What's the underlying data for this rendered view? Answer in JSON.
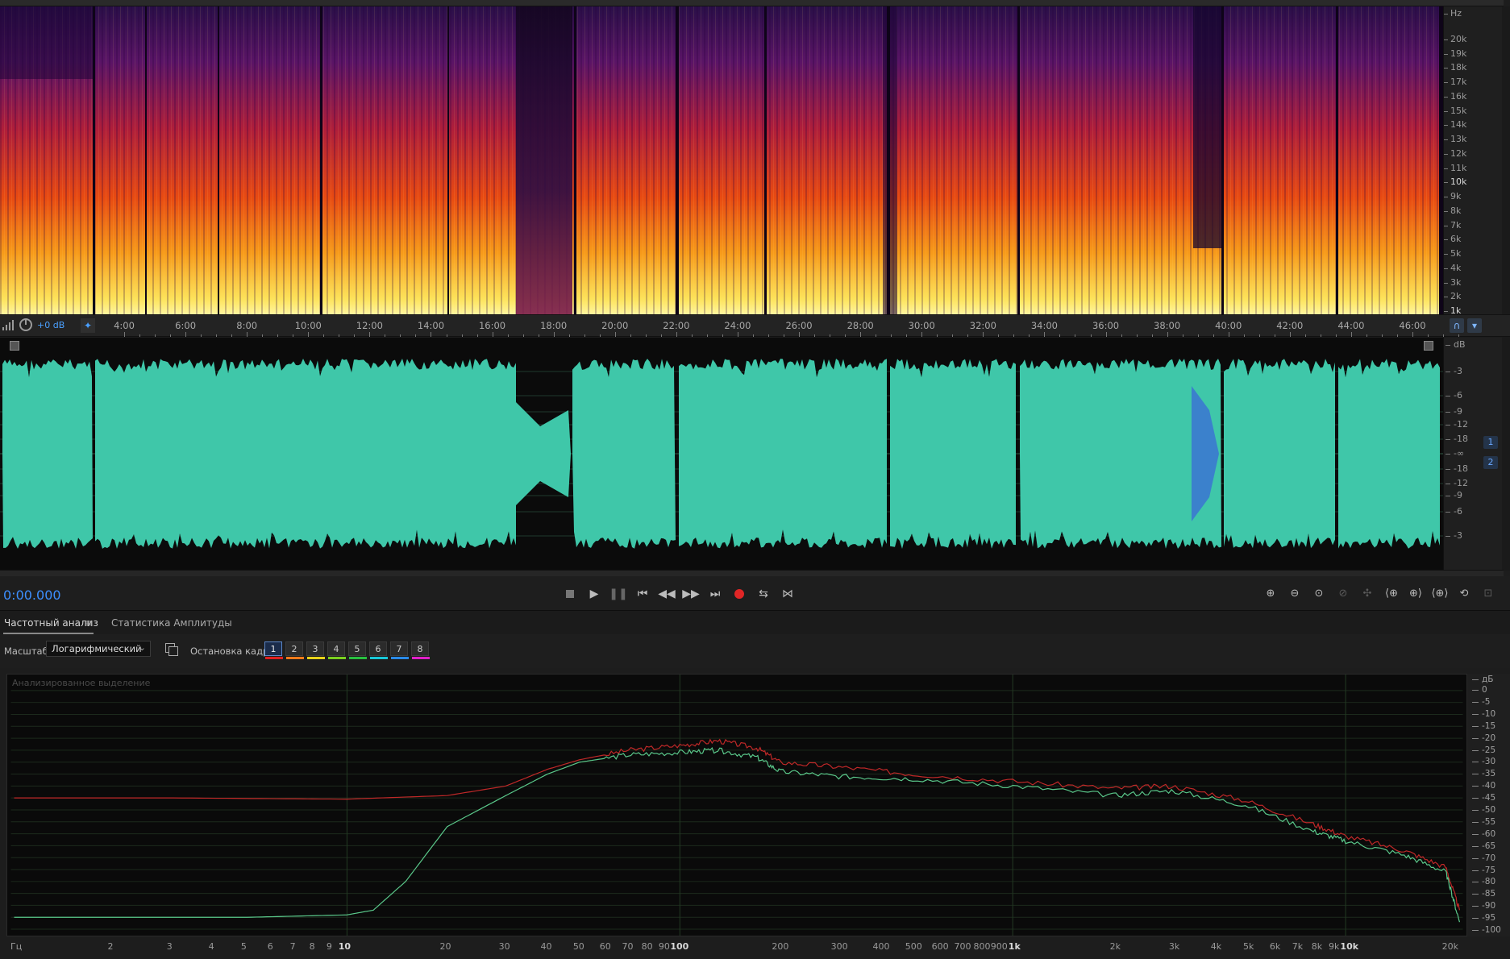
{
  "spectrogram": {
    "hz_unit": "Hz",
    "hz_ticks": [
      "20k",
      "19k",
      "18k",
      "17k",
      "16k",
      "15k",
      "14k",
      "13k",
      "12k",
      "11k",
      "10k",
      "9k",
      "8k",
      "7k",
      "6k",
      "5k",
      "4k",
      "3k",
      "2k",
      "1k"
    ]
  },
  "ruler": {
    "volume": "+0 dB",
    "time_labels": [
      "4:00",
      "6:00",
      "8:00",
      "10:00",
      "12:00",
      "14:00",
      "16:00",
      "18:00",
      "20:00",
      "22:00",
      "24:00",
      "26:00",
      "28:00",
      "30:00",
      "32:00",
      "34:00",
      "36:00",
      "38:00",
      "40:00",
      "42:00",
      "44:00",
      "46:00"
    ]
  },
  "waveform": {
    "db_unit": "dB",
    "db_ticks": [
      "-3",
      "-6",
      "-9",
      "-12",
      "-18",
      "-∞",
      "-18",
      "-12",
      "-9",
      "-6",
      "-3"
    ],
    "channels": [
      "1",
      "2"
    ]
  },
  "transport": {
    "timecode": "0:00.000"
  },
  "tabs": {
    "frequency": "Частотный анализ",
    "amplitude": "Статистика Амплитуды",
    "menu": "≡"
  },
  "controls": {
    "scale_label": "Масштаб:",
    "scale_value": "Логарифмический",
    "freeze_label": "Остановка кадра:",
    "frames": [
      {
        "label": "1",
        "color": "#e02020"
      },
      {
        "label": "2",
        "color": "#f07a1a"
      },
      {
        "label": "3",
        "color": "#e8d21a"
      },
      {
        "label": "4",
        "color": "#7ad020"
      },
      {
        "label": "5",
        "color": "#28c040"
      },
      {
        "label": "6",
        "color": "#18c8d8"
      },
      {
        "label": "7",
        "color": "#2a8ae8"
      },
      {
        "label": "8",
        "color": "#e020c8"
      }
    ]
  },
  "analysis": {
    "caption": "Анализированное выделение",
    "db_unit": "дБ",
    "db_ticks": [
      "0",
      "-5",
      "-10",
      "-15",
      "-20",
      "-25",
      "-30",
      "-35",
      "-40",
      "-45",
      "-50",
      "-55",
      "-60",
      "-65",
      "-70",
      "-75",
      "-80",
      "-85",
      "-90",
      "-95",
      "-100"
    ],
    "x_unit": "Гц",
    "x_ticks": [
      {
        "label": "2",
        "f": 2
      },
      {
        "label": "3",
        "f": 3
      },
      {
        "label": "4",
        "f": 4
      },
      {
        "label": "5",
        "f": 5
      },
      {
        "label": "6",
        "f": 6
      },
      {
        "label": "7",
        "f": 7
      },
      {
        "label": "8",
        "f": 8
      },
      {
        "label": "9",
        "f": 9
      },
      {
        "label": "10",
        "f": 10,
        "bold": true
      },
      {
        "label": "20",
        "f": 20
      },
      {
        "label": "30",
        "f": 30
      },
      {
        "label": "40",
        "f": 40
      },
      {
        "label": "50",
        "f": 50
      },
      {
        "label": "60",
        "f": 60
      },
      {
        "label": "70",
        "f": 70
      },
      {
        "label": "80",
        "f": 80
      },
      {
        "label": "90",
        "f": 90
      },
      {
        "label": "100",
        "f": 100,
        "bold": true
      },
      {
        "label": "200",
        "f": 200
      },
      {
        "label": "300",
        "f": 300
      },
      {
        "label": "400",
        "f": 400
      },
      {
        "label": "500",
        "f": 500
      },
      {
        "label": "600",
        "f": 600
      },
      {
        "label": "700",
        "f": 700
      },
      {
        "label": "800",
        "f": 800
      },
      {
        "label": "900",
        "f": 900
      },
      {
        "label": "1k",
        "f": 1000,
        "bold": true
      },
      {
        "label": "2k",
        "f": 2000
      },
      {
        "label": "3k",
        "f": 3000
      },
      {
        "label": "4k",
        "f": 4000
      },
      {
        "label": "5k",
        "f": 5000
      },
      {
        "label": "6k",
        "f": 6000
      },
      {
        "label": "7k",
        "f": 7000
      },
      {
        "label": "8k",
        "f": 8000
      },
      {
        "label": "9k",
        "f": 9000
      },
      {
        "label": "10k",
        "f": 10000,
        "bold": true
      },
      {
        "label": "20k",
        "f": 20000
      }
    ],
    "colors": {
      "peak": "#c02828",
      "avg": "#5ac88a"
    }
  },
  "chart_data": {
    "type": "line",
    "xlabel": "Гц",
    "ylabel": "дБ",
    "xscale": "log",
    "xlim": [
      1,
      22000
    ],
    "ylim": [
      -100,
      0
    ],
    "grid": true,
    "series": [
      {
        "color": "#c02828",
        "x": [
          1,
          3,
          10,
          20,
          30,
          40,
          50,
          70,
          100,
          130,
          170,
          200,
          300,
          500,
          1000,
          2000,
          3000,
          5000,
          8000,
          10000,
          15000,
          20000,
          22000
        ],
        "y": [
          -45,
          -45,
          -45.5,
          -44,
          -40,
          -33,
          -29,
          -25,
          -23,
          -21,
          -24,
          -30,
          -32,
          -35,
          -38,
          -41,
          -40,
          -46,
          -56,
          -61,
          -67,
          -74,
          -92
        ]
      },
      {
        "color": "#5ac88a",
        "x": [
          1,
          5,
          10,
          12,
          15,
          20,
          30,
          40,
          50,
          70,
          100,
          130,
          170,
          200,
          300,
          500,
          1000,
          2000,
          3000,
          5000,
          8000,
          10000,
          15000,
          20000,
          22000
        ],
        "y": [
          -95,
          -95,
          -94,
          -92,
          -80,
          -57,
          -44,
          -35,
          -30,
          -27,
          -26,
          -25,
          -28,
          -34,
          -36,
          -37,
          -40,
          -44,
          -42,
          -48,
          -59,
          -63,
          -69,
          -76,
          -97
        ]
      }
    ]
  }
}
